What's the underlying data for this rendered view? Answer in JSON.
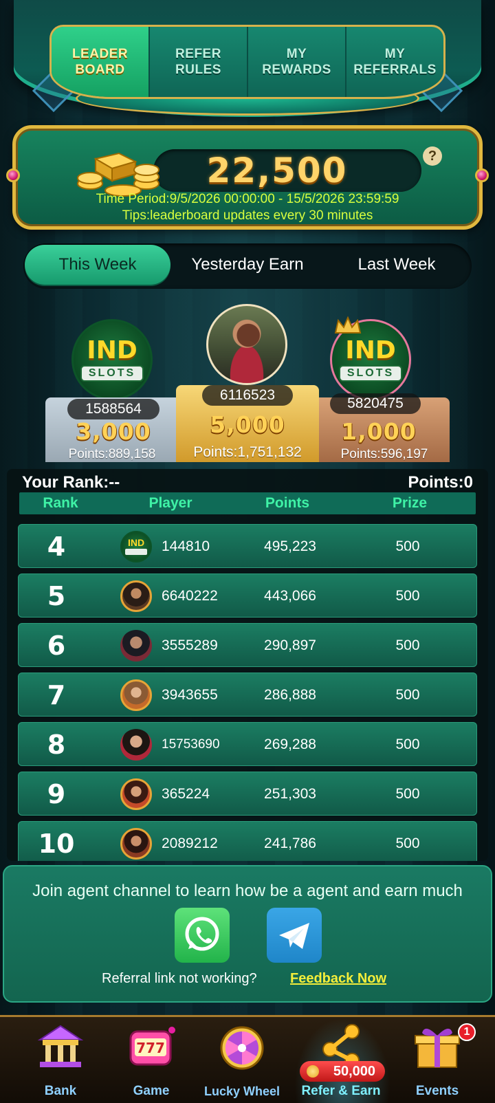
{
  "top_tabs": [
    {
      "label": "LEADER\nBOARD",
      "active": true
    },
    {
      "label": "REFER\nRULES",
      "active": false
    },
    {
      "label": "MY\nREWARDS",
      "active": false
    },
    {
      "label": "MY\nREFERRALS",
      "active": false
    }
  ],
  "pool": {
    "amount": "22,500",
    "help": "?",
    "period": "Time Period:9/5/2026 00:00:00 - 15/5/2026 23:59:59",
    "tips": "Tips:leaderboard updates every 30 minutes"
  },
  "period_tabs": [
    "This Week",
    "Yesterday Earn",
    "Last Week"
  ],
  "podium": {
    "first": {
      "id": "6116523",
      "prize": "5,000",
      "points": "Points:1,751,132"
    },
    "second": {
      "id": "1588564",
      "prize": "3,000",
      "points": "Points:889,158"
    },
    "third": {
      "id": "5820475",
      "prize": "1,000",
      "points": "Points:596,197"
    },
    "logo_text_top": "IND",
    "logo_text_bottom": "SLOTS"
  },
  "your_rank": {
    "rank_label": "Your Rank:--",
    "points_label": "Points:0"
  },
  "table": {
    "headers": [
      "Rank",
      "Player",
      "Points",
      "Prize"
    ],
    "rows": [
      {
        "rank": "4",
        "player": "144810",
        "points": "495,223",
        "prize": "500"
      },
      {
        "rank": "5",
        "player": "6640222",
        "points": "443,066",
        "prize": "500"
      },
      {
        "rank": "6",
        "player": "3555289",
        "points": "290,897",
        "prize": "500"
      },
      {
        "rank": "7",
        "player": "3943655",
        "points": "286,888",
        "prize": "500"
      },
      {
        "rank": "8",
        "player": "15753690",
        "points": "269,288",
        "prize": "500"
      },
      {
        "rank": "9",
        "player": "365224",
        "points": "251,303",
        "prize": "500"
      },
      {
        "rank": "10",
        "player": "2089212",
        "points": "241,786",
        "prize": "500"
      }
    ]
  },
  "agent": {
    "title": "Join agent channel to learn how be a agent and earn much",
    "question": "Referral link not working?",
    "feedback": "Feedback Now"
  },
  "nav": {
    "items": [
      "Bank",
      "Game",
      "Lucky Wheel",
      "Refer & Earn",
      "Events"
    ],
    "coins_badge": "50,000",
    "events_badge": "1"
  },
  "colors": {
    "accent_green": "#17845e",
    "gold": "#e1b83e",
    "tips_text": "#d9ff3e",
    "header_text": "#3ff2a6"
  }
}
